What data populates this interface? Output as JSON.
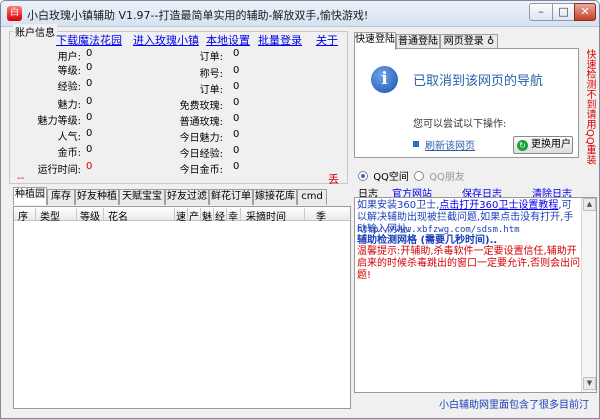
{
  "window": {
    "title": "小白玫瑰小镇辅助 V1.97--打造最简单实用的辅助-解放双手,愉快游戏!",
    "app_icon_glyph": "白"
  },
  "account": {
    "legend": "账户信息",
    "links": [
      "下载魔法花园",
      "进入玫瑰小镇",
      "本地设置",
      "批量登录",
      "关于"
    ],
    "left_fields": [
      {
        "label": "用户:",
        "value": "0"
      },
      {
        "label": "等级:",
        "value": "0"
      },
      {
        "label": "经验:",
        "value": "0"
      },
      {
        "label": "魅力:",
        "value": "0"
      },
      {
        "label": "魅力等级:",
        "value": "0"
      },
      {
        "label": "人气:",
        "value": "0"
      },
      {
        "label": "金币:",
        "value": "0"
      },
      {
        "label": "运行时间:",
        "value": "0"
      }
    ],
    "right_fields": [
      {
        "label": "订单:",
        "value": "0"
      },
      {
        "label": "称号:",
        "value": "0"
      },
      {
        "label": "订单:",
        "value": "0"
      },
      {
        "label": "免费玫瑰:",
        "value": "0"
      },
      {
        "label": "普通玫瑰:",
        "value": "0"
      },
      {
        "label": "今日魅力:",
        "value": "0"
      },
      {
        "label": "今日经验:",
        "value": "0"
      },
      {
        "label": "今日金币:",
        "value": "0"
      }
    ],
    "corner_left": "--",
    "corner_right": "丢"
  },
  "main_tabs": [
    "种植园",
    "库存",
    "好友种植",
    "天赋宝宝",
    "好友过滤",
    "鲜花订单",
    "嫁接花库",
    "cmd"
  ],
  "table_columns": [
    "序",
    "类型",
    "等级",
    "花名",
    "速",
    "产",
    "魅",
    "经",
    "幸",
    "采摘时间",
    "季"
  ],
  "login_tabs": [
    "快速登陆",
    "普通登陆",
    "网页登录"
  ],
  "login_tab_extra_glyph": "♁",
  "browser": {
    "message": "已取消到该网页的导航",
    "hint": "您可以尝试以下操作:",
    "refresh_link": "刷新该网页",
    "switch_button": "更换用户"
  },
  "side_notice": "快速检测不到请用QQ重装",
  "login_mode": {
    "options": [
      "QQ空间",
      "QQ朋友"
    ],
    "selected": 0
  },
  "log_toolbar": {
    "label": "日志",
    "links": [
      "官方网站",
      "保存日志",
      "清除日志"
    ]
  },
  "log": {
    "line1_prefix": "如果安装360卫士,",
    "line1_link": "点击打开360卫士设置教程",
    "line1_suffix": ",可以解决辅助出现被拦截问题,如果点击没有打开,手动输入网址:",
    "url1": "http://www.xbfzwg.com/sdsm.htm",
    "detect": "辅助检测网格 (需要几秒时间)..",
    "warning": "温馨提示:开辅助,杀毒软件一定要设置信任,辅助开启来的时候杀毒跳出的窗口一定要允许,否则会出问题!"
  },
  "footer": "小白辅助网里面包含了很多目前汀",
  "colors": {
    "link": "#0000ee",
    "accent_red": "#d40000",
    "title_gradient_top": "#eef3fa"
  }
}
